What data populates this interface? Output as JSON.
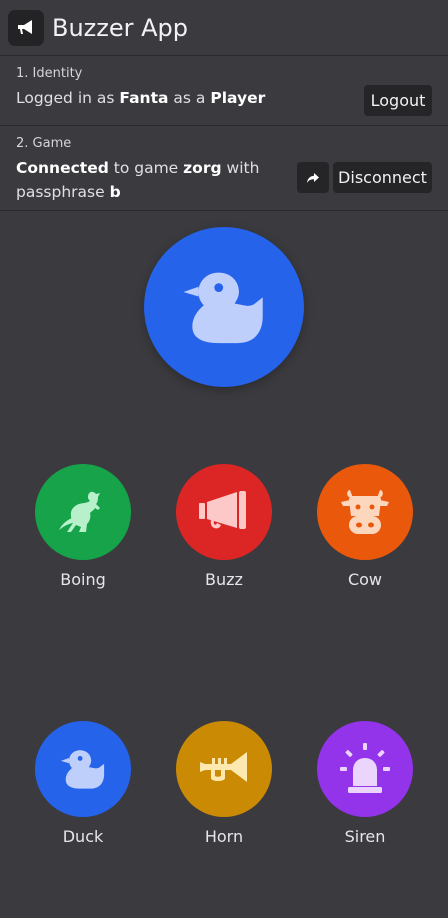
{
  "header": {
    "title": "Buzzer App",
    "icon": "megaphone-icon"
  },
  "identity": {
    "heading": "1. Identity",
    "prefix": "Logged in as",
    "user": "Fanta",
    "middle": "as a",
    "role": "Player",
    "logout_label": "Logout"
  },
  "game": {
    "heading": "2. Game",
    "status": "Connected",
    "text1": "to game",
    "game_name": "zorg",
    "text2": "with passphrase",
    "passphrase": "b",
    "share_icon": "share-icon",
    "disconnect_label": "Disconnect"
  },
  "main_buzzer": {
    "icon": "duck-icon",
    "color": "#2563eb"
  },
  "sounds": [
    {
      "label": "Boing",
      "icon": "kangaroo-icon",
      "color": "#16a34a"
    },
    {
      "label": "Buzz",
      "icon": "megaphone-icon",
      "color": "#dc2626"
    },
    {
      "label": "Cow",
      "icon": "cow-icon",
      "color": "#ea580c"
    },
    {
      "label": "Duck",
      "icon": "duck-icon",
      "color": "#2563eb"
    },
    {
      "label": "Horn",
      "icon": "horn-icon",
      "color": "#ca8a04"
    },
    {
      "label": "Siren",
      "icon": "siren-icon",
      "color": "#9333ea"
    }
  ]
}
